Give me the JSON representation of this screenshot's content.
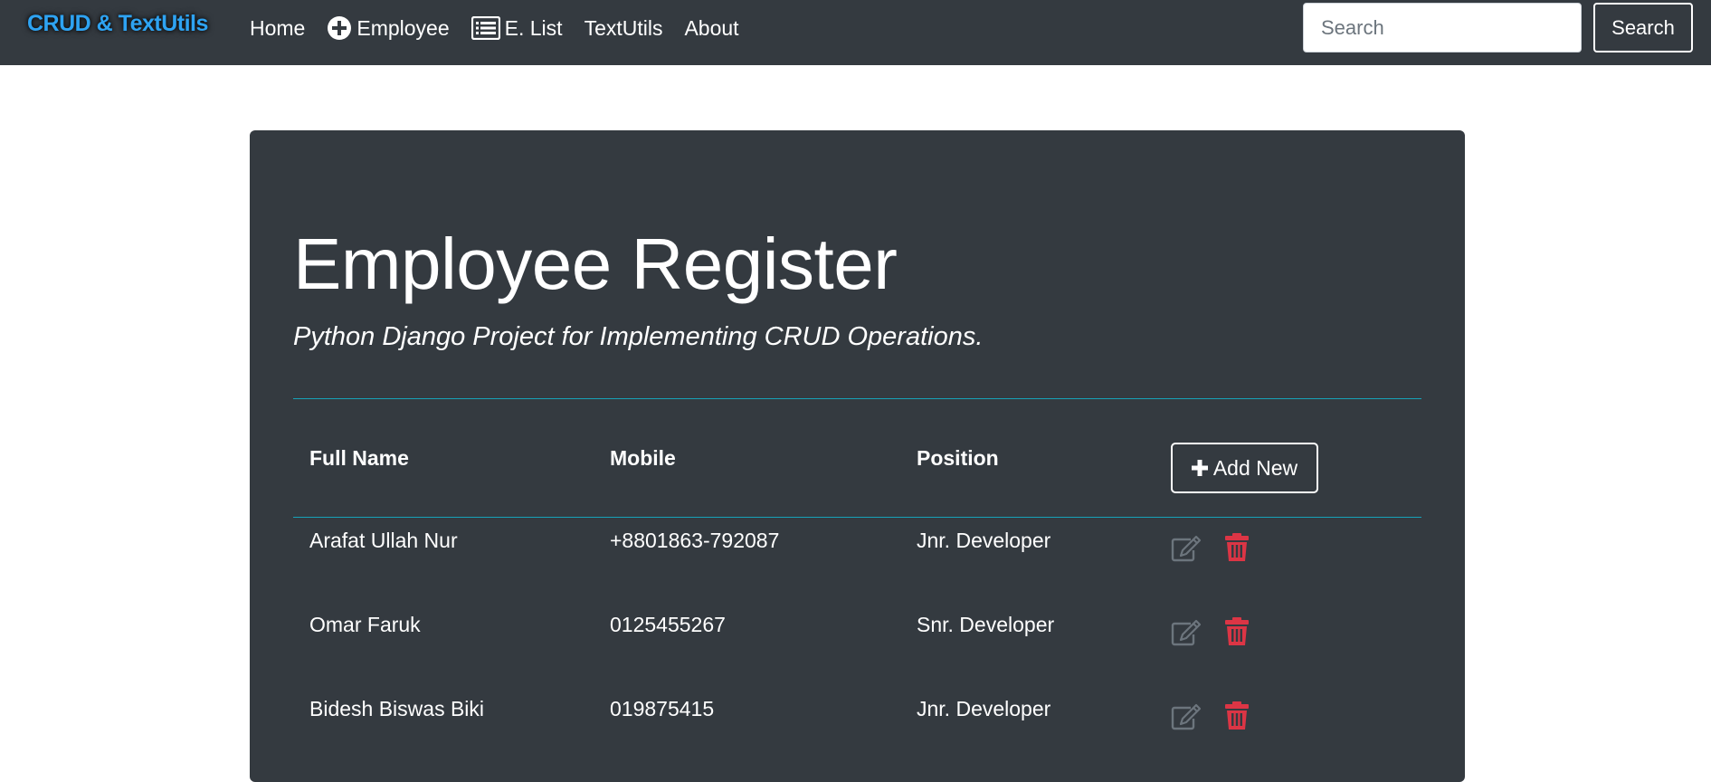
{
  "navbar": {
    "brand": "CRUD & TextUtils",
    "links": [
      {
        "label": "Home",
        "icon": null
      },
      {
        "label": "Employee",
        "icon": "plus-circle-icon"
      },
      {
        "label": "E. List",
        "icon": "list-icon"
      },
      {
        "label": "TextUtils",
        "icon": null
      },
      {
        "label": "About",
        "icon": null
      }
    ],
    "search_placeholder": "Search",
    "search_button": "Search"
  },
  "main": {
    "title": "Employee Register",
    "subtitle": "Python Django Project for Implementing CRUD Operations.",
    "table": {
      "headers": [
        "Full Name",
        "Mobile",
        "Position"
      ],
      "add_button": "Add New",
      "rows": [
        {
          "name": "Arafat Ullah Nur",
          "mobile": "+8801863-792087",
          "position": "Jnr. Developer"
        },
        {
          "name": "Omar Faruk",
          "mobile": "0125455267",
          "position": "Snr. Developer"
        },
        {
          "name": "Bidesh Biswas Biki",
          "mobile": "019875415",
          "position": "Jnr. Developer"
        }
      ]
    }
  },
  "colors": {
    "navbar_bg": "#343a40",
    "brand": "#2ea3f2",
    "accent_line": "#17a2b8",
    "delete": "#dc3545",
    "edit": "#6c757d"
  }
}
